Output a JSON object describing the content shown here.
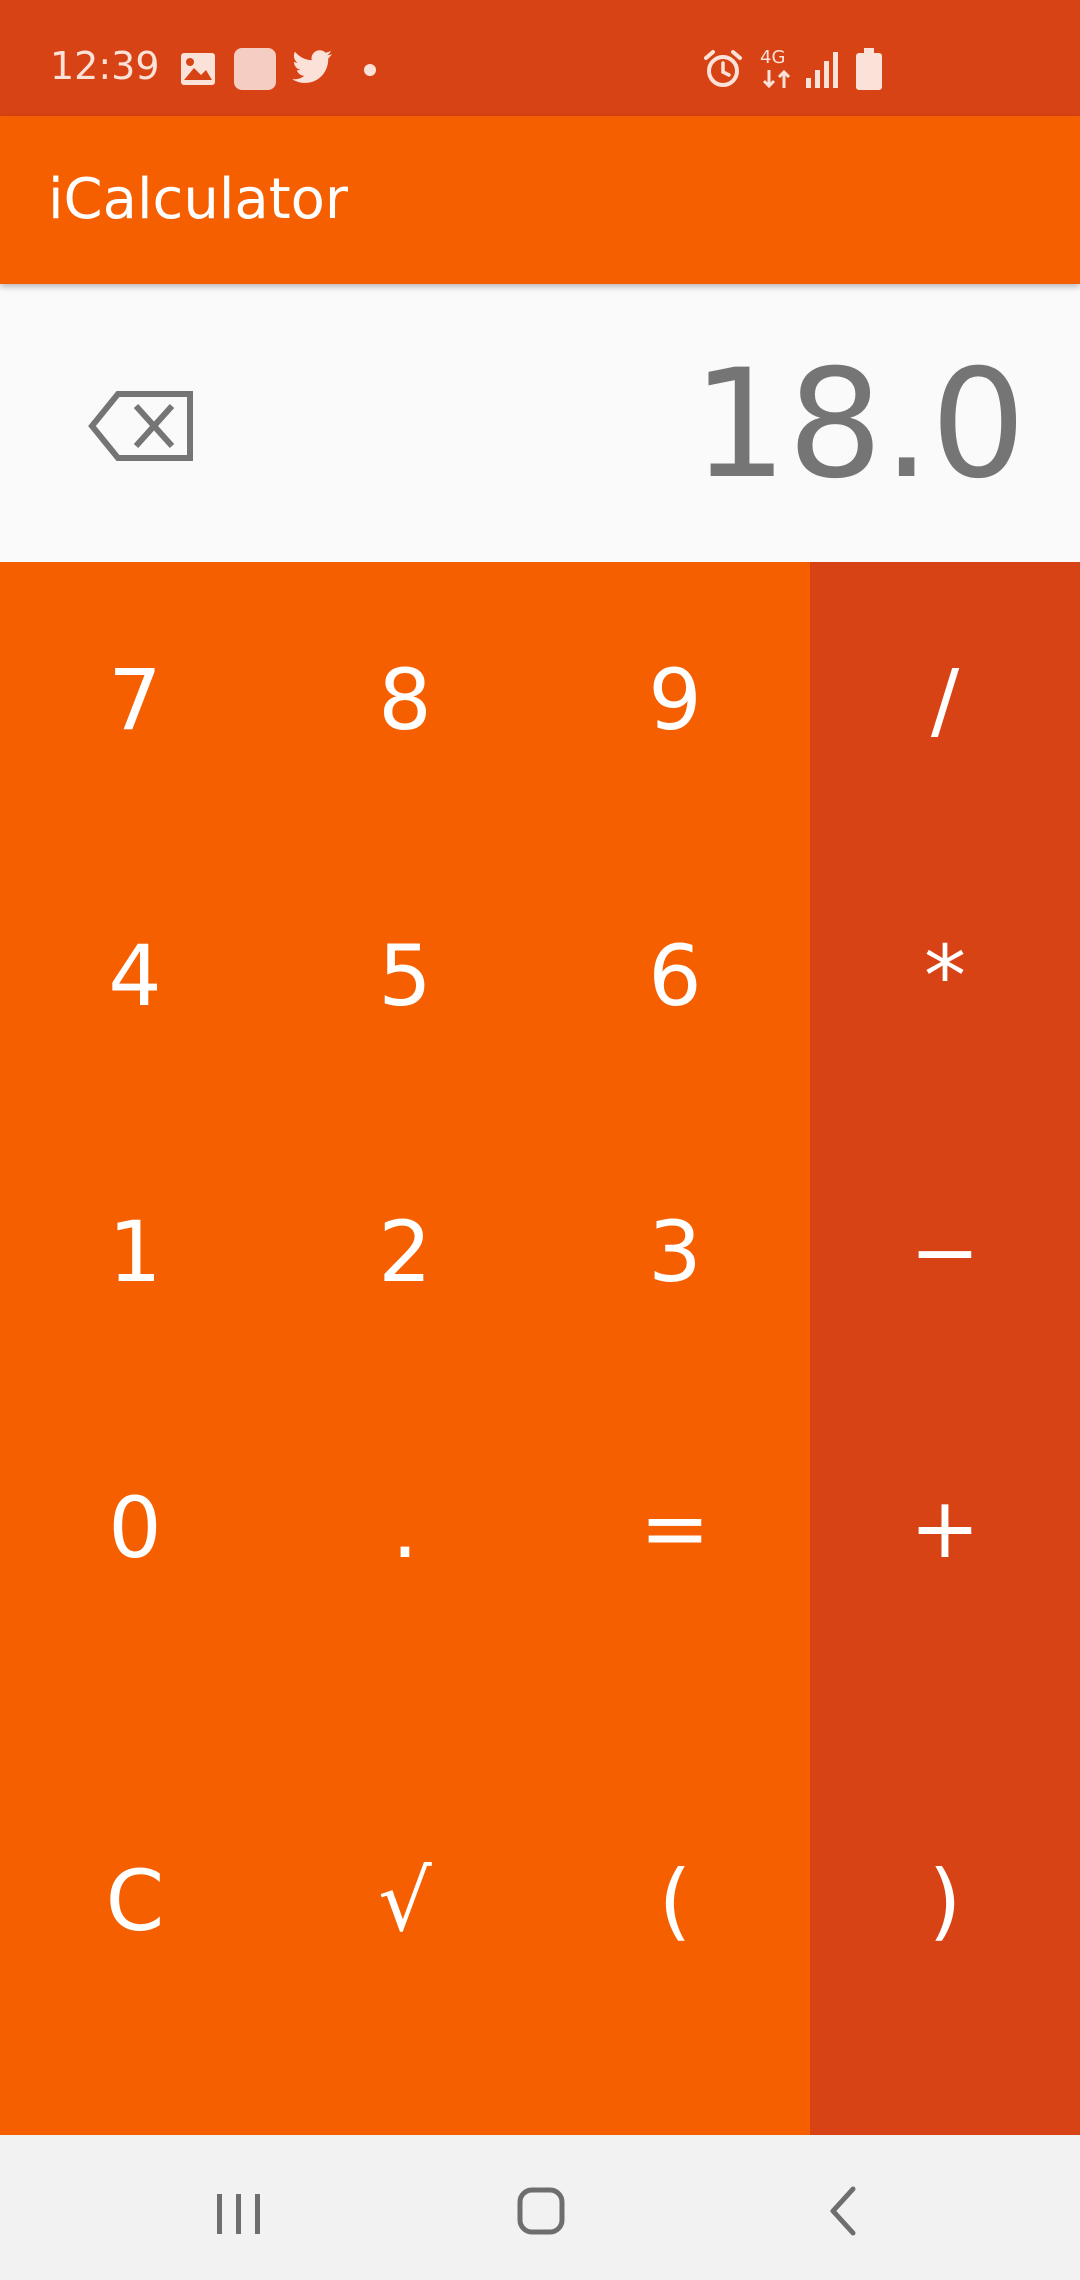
{
  "status_bar": {
    "time": "12:39",
    "icons": [
      "gallery-icon",
      "app-square-icon",
      "twitter-icon",
      "dot-icon",
      "alarm-icon",
      "network-4g-icon",
      "signal-icon",
      "battery-icon"
    ],
    "network": "4G"
  },
  "app_bar": {
    "title": "iCalculator"
  },
  "display": {
    "value": "18.0",
    "backspace_icon": "backspace-icon"
  },
  "keypad": {
    "row1": [
      "7",
      "8",
      "9"
    ],
    "row2": [
      "4",
      "5",
      "6"
    ],
    "row3": [
      "1",
      "2",
      "3"
    ],
    "row4": [
      "0",
      ".",
      "="
    ],
    "row5": [
      "C",
      "√",
      "("
    ],
    "operators": [
      "/",
      "*",
      "−",
      "+",
      ")"
    ]
  },
  "nav_bar": {
    "icons": [
      "recent-apps-icon",
      "home-icon",
      "back-icon"
    ]
  },
  "colors": {
    "status_bar": "#d84315",
    "app_bar": "#f55f00",
    "keypad_main": "#f55f00",
    "keypad_ops": "#d84315",
    "display_bg": "#fafafa",
    "display_text": "#757575"
  }
}
